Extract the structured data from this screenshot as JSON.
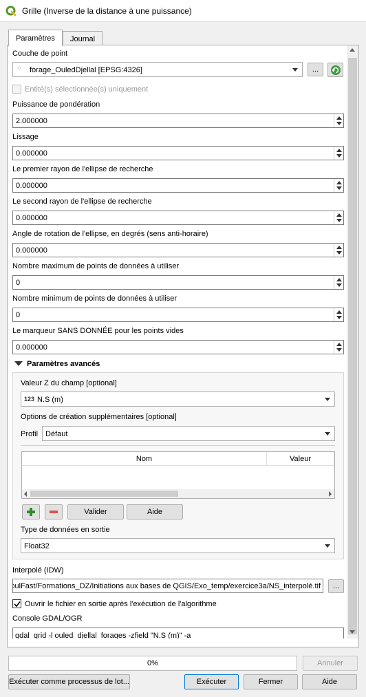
{
  "window": {
    "title": "Grille (Inverse de la distance à une puissance)"
  },
  "tabs": [
    {
      "label": "Paramètres"
    },
    {
      "label": "Journal"
    }
  ],
  "params": {
    "point_layer_label": "Couche de point",
    "point_layer_value": "forage_OuledDjellal [EPSG:4326]",
    "browse_label": "...",
    "selected_only_label": "Entité(s) sélectionnée(s) uniquement",
    "power_label": "Puissance de pondération",
    "power_value": "2.000000",
    "smoothing_label": "Lissage",
    "smoothing_value": "0.000000",
    "radius1_label": "Le premier rayon de l'ellipse de recherche",
    "radius1_value": "0.000000",
    "radius2_label": "Le second rayon de l'ellipse de recherche",
    "radius2_value": "0.000000",
    "angle_label": "Angle de rotation de l'ellipse, en degrés (sens anti-horaire)",
    "angle_value": "0.000000",
    "max_points_label": "Nombre maximum de points de données à utiliser",
    "max_points_value": "0",
    "min_points_label": "Nombre minimum de points de données à utiliser",
    "min_points_value": "0",
    "nodata_label": "Le marqueur SANS DONNÉE pour les points vides",
    "nodata_value": "0.000000"
  },
  "advanced": {
    "header": "Paramètres avancés",
    "z_field_label": "Valeur Z du champ [optional]",
    "z_field_type": "123",
    "z_field_value": "N.S (m)",
    "creation_options_label": "Options de création supplémentaires [optional]",
    "profile_label": "Profil",
    "profile_value": "Défaut",
    "table_headers": {
      "name": "Nom",
      "value": "Valeur"
    },
    "validate_label": "Valider",
    "help_label": "Aide",
    "output_type_label": "Type de données en sortie",
    "output_type_value": "Float32"
  },
  "output": {
    "interp_label": "Interpolé (IDW)",
    "interp_value": "MoulFast/Formations_DZ/Initiations aux bases de QGIS/Exo_temp/exercice3a/NS_interpolé.tif",
    "browse_label": "...",
    "open_after_label": "Ouvrir le fichier en sortie après l'exécution de l'algorithme",
    "console_label": "Console GDAL/OGR",
    "console_value": "gdal_grid -l ouled_djellal_forages -zfield \"N.S (m)\" -a"
  },
  "progress": {
    "text": "0%",
    "percent": 0
  },
  "buttons": {
    "cancel": "Annuler",
    "batch": "Exécuter comme processus de lot...",
    "run": "Exécuter",
    "close": "Fermer",
    "help": "Aide"
  },
  "colors": {
    "accent": "#0078d7",
    "qgis_green": "#589632",
    "add_green": "#2e8b2e",
    "remove_red": "#d9534f"
  }
}
